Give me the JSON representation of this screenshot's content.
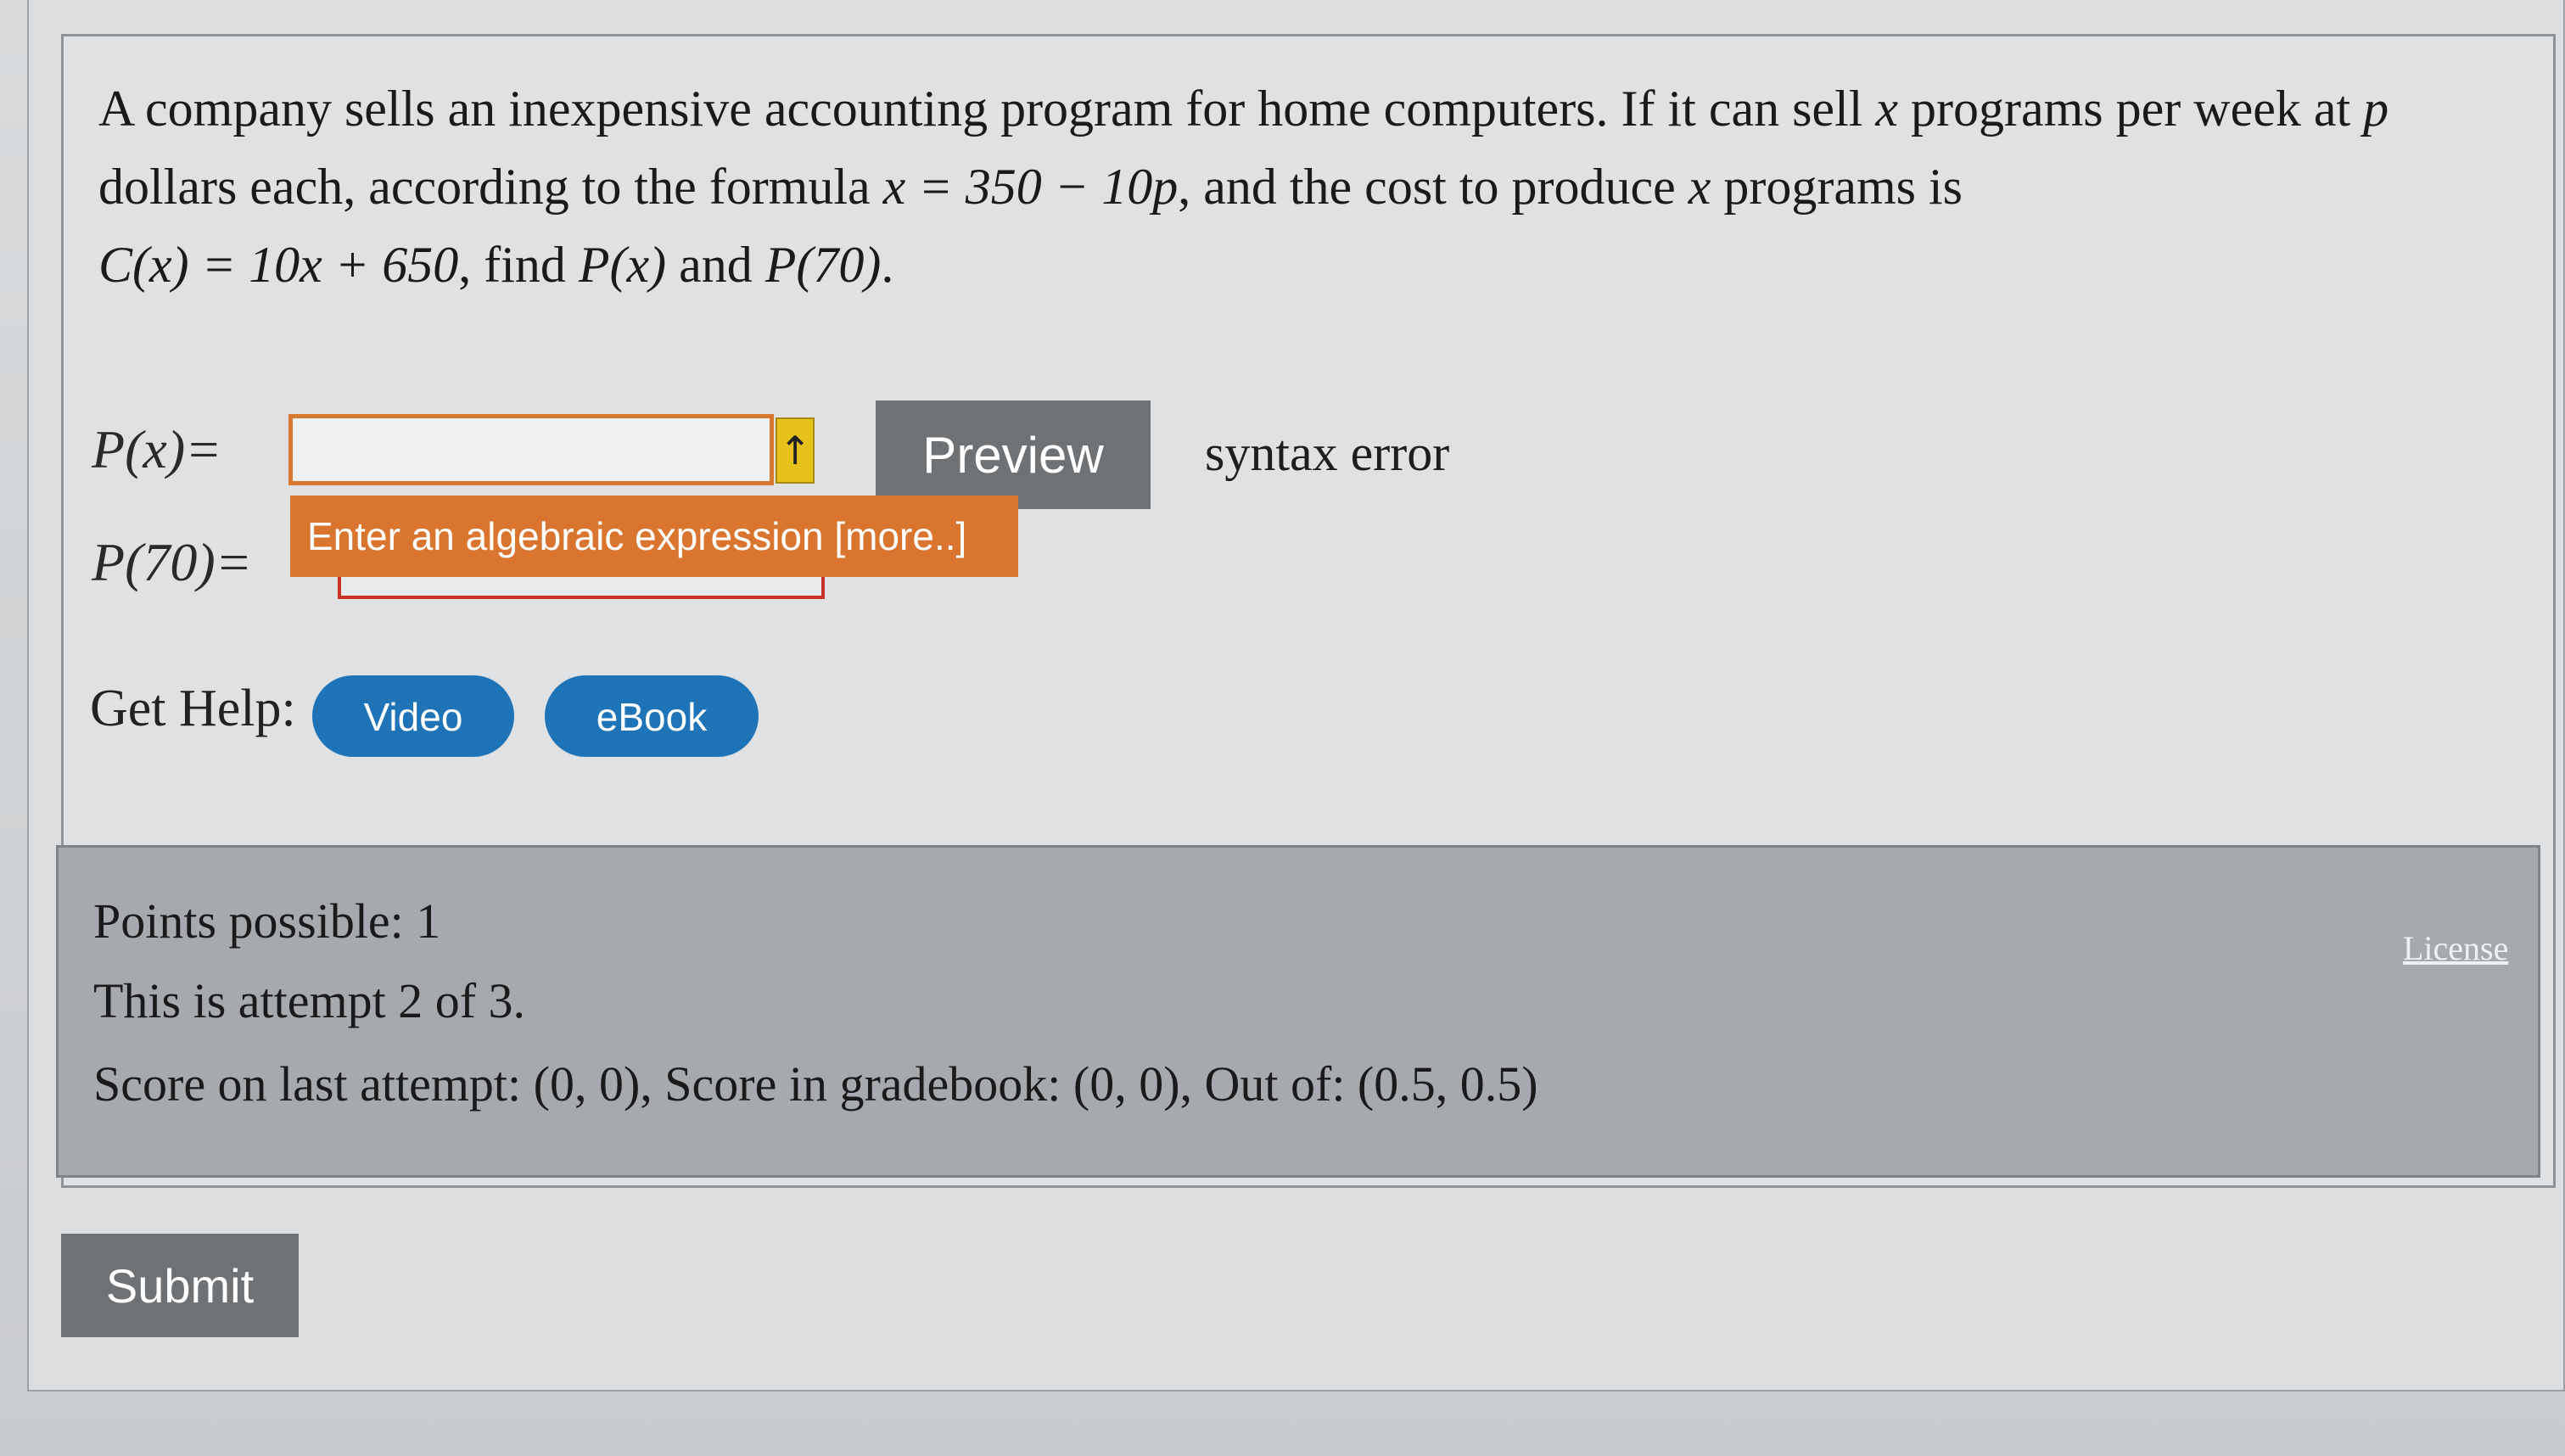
{
  "question": {
    "line1_a": "A company sells an inexpensive accounting program for home computers. If it can sell ",
    "var_x": "x",
    "line1_b": " programs per week at ",
    "var_p": "p",
    "line2_a": "dollars each, according to the formula ",
    "formula_demand": "x = 350 − 10p",
    "line2_b": ", and the cost to produce ",
    "line2_c": " programs is",
    "formula_cost": "C(x) = 10x + 650",
    "line3_b": ", find ",
    "px_term": "P(x)",
    "line3_c": " and ",
    "p70_term": "P(70)",
    "line3_end": "."
  },
  "answers": {
    "px_label": "P(x)",
    "px_eq": " =",
    "px_value": "",
    "p70_label": "P(70)",
    "p70_eq": " =",
    "p70_value": ""
  },
  "arrow_glyph": "↑",
  "preview_label": "Preview",
  "syntax_error_text": "syntax error",
  "tooltip_text": "Enter an algebraic expression [more..]",
  "help": {
    "label": "Get Help:",
    "video_label": "Video",
    "ebook_label": "eBook"
  },
  "info": {
    "points": "Points possible: 1",
    "attempt": "This is attempt 2 of 3.",
    "score": "Score on last attempt: (0, 0), Score in gradebook: (0, 0), Out of: (0.5, 0.5)",
    "license": "License"
  },
  "submit_label": "Submit",
  "colors": {
    "tooltip": "#d9752e",
    "help_button": "#1f74b8",
    "preview_button": "#6f7275",
    "error_border": "#c9302c"
  }
}
